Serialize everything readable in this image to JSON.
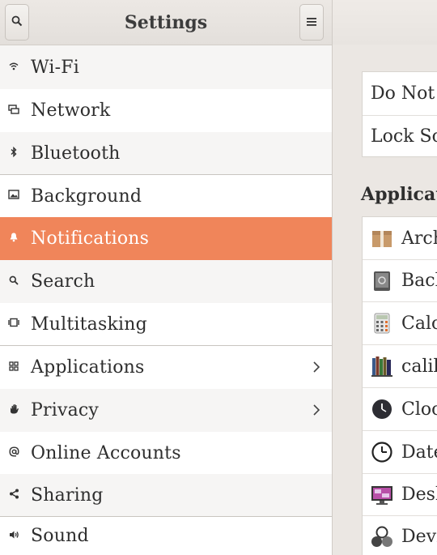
{
  "header": {
    "title": "Settings",
    "search_icon": "search-icon",
    "menu_icon": "hamburger-menu-icon"
  },
  "sidebar": {
    "items": [
      {
        "label": "Wi-Fi",
        "icon": "wifi-icon"
      },
      {
        "label": "Network",
        "icon": "network-icon"
      },
      {
        "label": "Bluetooth",
        "icon": "bluetooth-icon"
      },
      {
        "label": "Background",
        "icon": "background-icon"
      },
      {
        "label": "Notifications",
        "icon": "bell-icon",
        "selected": true
      },
      {
        "label": "Search",
        "icon": "search-icon"
      },
      {
        "label": "Multitasking",
        "icon": "multitasking-icon"
      },
      {
        "label": "Applications",
        "icon": "grid-icon",
        "has_submenu": true
      },
      {
        "label": "Privacy",
        "icon": "hand-icon",
        "has_submenu": true
      },
      {
        "label": "Online Accounts",
        "icon": "at-icon"
      },
      {
        "label": "Sharing",
        "icon": "share-icon"
      },
      {
        "label": "Sound",
        "icon": "speaker-icon"
      }
    ]
  },
  "main": {
    "settings_rows": [
      {
        "label": "Do Not Disturb"
      },
      {
        "label": "Lock Screen Notifications"
      }
    ],
    "applications_title": "Applications",
    "apps": [
      {
        "label": "Archive Manager",
        "icon": "archive-icon"
      },
      {
        "label": "Backups",
        "icon": "backups-icon"
      },
      {
        "label": "Calculator",
        "icon": "calculator-icon"
      },
      {
        "label": "calibre",
        "icon": "calibre-icon"
      },
      {
        "label": "Clocks",
        "icon": "clock-icon"
      },
      {
        "label": "Date & Time",
        "icon": "date-time-icon"
      },
      {
        "label": "Desktop",
        "icon": "desktop-icon"
      },
      {
        "label": "Devices",
        "icon": "devices-icon"
      }
    ]
  },
  "colors": {
    "selected_bg": "#f0855a",
    "window_bg": "#ebe7e3"
  }
}
